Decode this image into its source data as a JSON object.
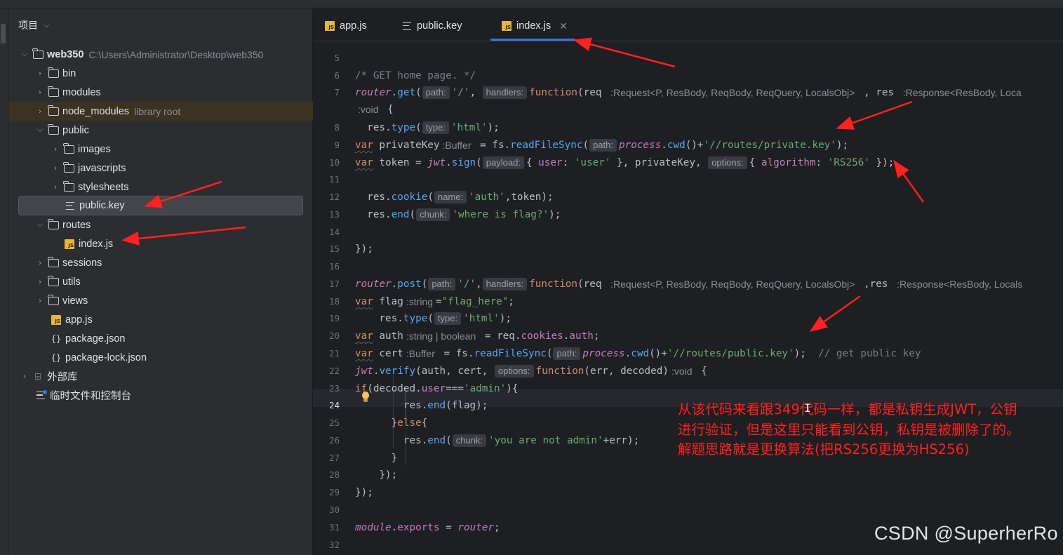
{
  "project": {
    "header": "项目",
    "root": {
      "name": "web350",
      "path": "C:\\Users\\Administrator\\Desktop\\web350"
    },
    "items": [
      {
        "label": "bin"
      },
      {
        "label": "modules"
      },
      {
        "label": "node_modules",
        "note": "library root"
      },
      {
        "label": "public"
      },
      {
        "label": "images"
      },
      {
        "label": "javascripts"
      },
      {
        "label": "stylesheets"
      },
      {
        "label": "public.key"
      },
      {
        "label": "routes"
      },
      {
        "label": "index.js"
      },
      {
        "label": "sessions"
      },
      {
        "label": "utils"
      },
      {
        "label": "views"
      },
      {
        "label": "app.js"
      },
      {
        "label": "package.json"
      },
      {
        "label": "package-lock.json"
      },
      {
        "label": "外部库"
      },
      {
        "label": "临时文件和控制台"
      }
    ]
  },
  "tabs": [
    {
      "label": "app.js",
      "icon": "js-file-icon"
    },
    {
      "label": "public.key",
      "icon": "text-file-icon"
    },
    {
      "label": "index.js",
      "icon": "js-file-icon",
      "active": true
    }
  ],
  "lines": [
    "5",
    "6",
    "7",
    "8",
    "9",
    "10",
    "11",
    "12",
    "13",
    "14",
    "15",
    "16",
    "17",
    "18",
    "19",
    "20",
    "21",
    "22",
    "23",
    "24",
    "25",
    "26",
    "27",
    "28",
    "29",
    "30",
    "31",
    "32"
  ],
  "hints": {
    "path": "path:",
    "handlers": "handlers:",
    "type": "type:",
    "payload": "payload:",
    "options": "options:",
    "name": "name:",
    "chunk": "chunk:",
    "req_type": ":Request<P, ResBody, ReqBody, ReqQuery, LocalsObj>",
    "res_type": ":Response<ResBody, Loca",
    "res_type2": ":Response<ResBody, Locals",
    "void": ":void",
    "buffer": ":Buffer",
    "string": ":string",
    "string_bool": ":string | boolean"
  },
  "code": {
    "l6": "/* GET home page. */",
    "s_slash": "'/'",
    "s_html": "'html'",
    "s_privkey": "'//routes/private.key'",
    "s_user": "'user'",
    "s_rs256": "'RS256'",
    "s_auth": "'auth'",
    "s_where": "'where is flag?'",
    "s_flaghere": "\"flag_here\"",
    "s_pubkey": "'//routes/public.key'",
    "c_getpub": "// get public key",
    "s_admin": "'admin'",
    "s_notadmin": "'you are not admin'"
  },
  "annotation": [
    "从该代码来看跟349代码一样，都是私钥生成JWT，公钥",
    "进行验证，但是这里只能看到公钥，私钥是被删除了的。",
    "解题思路就是更换算法(把RS256更换为HS256)"
  ],
  "watermark": "CSDN @SuperherRo",
  "colors": {
    "accent": "#3574f0",
    "annotation": "#ff2020",
    "js_icon": "#e8b73a"
  }
}
